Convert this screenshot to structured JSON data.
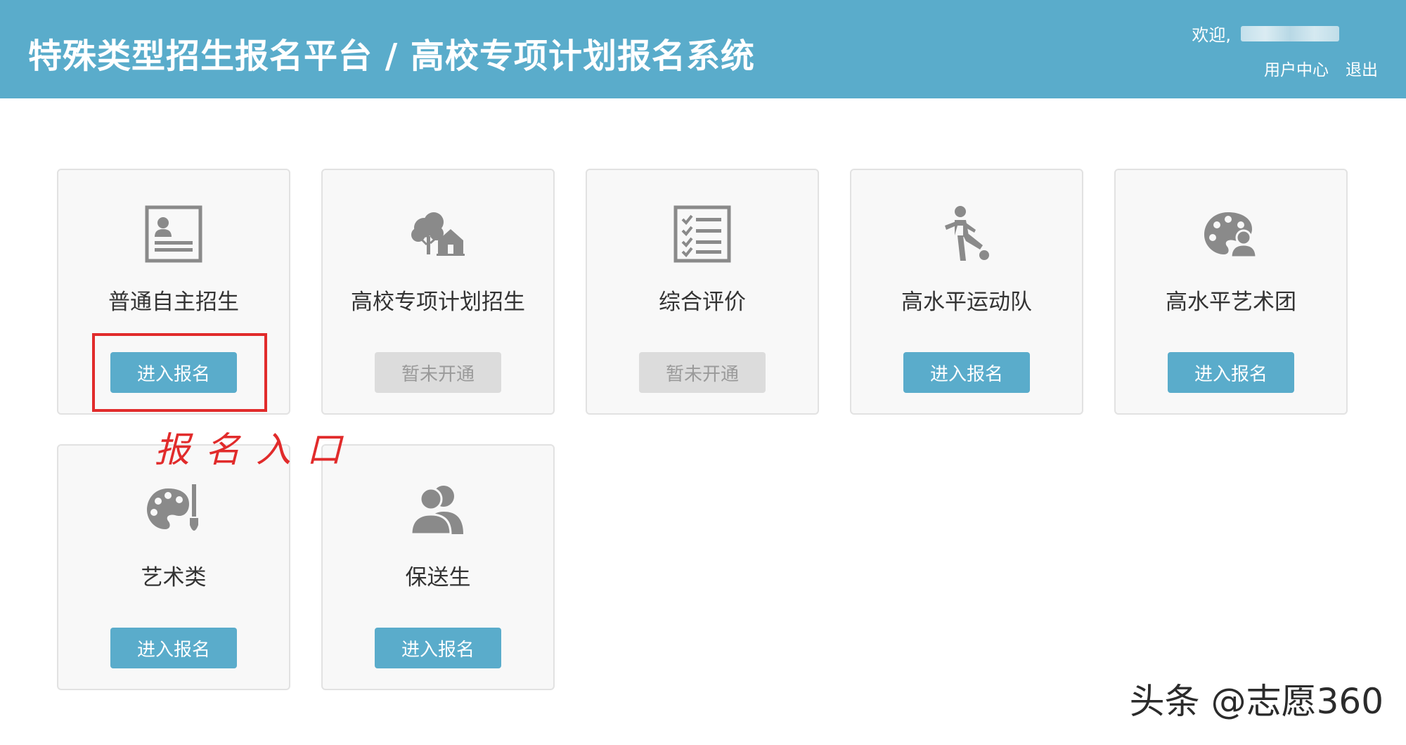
{
  "header": {
    "title": "特殊类型招生报名平台 / 高校专项计划报名系统",
    "welcome_text": "欢迎,",
    "user_center_link": "用户中心",
    "logout_link": "退出",
    "background_color": "#5aaccb"
  },
  "cards": [
    {
      "title": "普通自主招生",
      "icon": "id-card-icon",
      "button_label": "进入报名",
      "button_enabled": true
    },
    {
      "title": "高校专项计划招生",
      "icon": "tree-house-icon",
      "button_label": "暂未开通",
      "button_enabled": false
    },
    {
      "title": "综合评价",
      "icon": "checklist-icon",
      "button_label": "暂未开通",
      "button_enabled": false
    },
    {
      "title": "高水平运动队",
      "icon": "soccer-player-icon",
      "button_label": "进入报名",
      "button_enabled": true
    },
    {
      "title": "高水平艺术团",
      "icon": "palette-person-icon",
      "button_label": "进入报名",
      "button_enabled": true
    },
    {
      "title": "艺术类",
      "icon": "palette-brush-icon",
      "button_label": "进入报名",
      "button_enabled": true
    },
    {
      "title": "保送生",
      "icon": "users-icon",
      "button_label": "进入报名",
      "button_enabled": true
    }
  ],
  "annotation": {
    "text": "报名入口",
    "color": "#e12b2b"
  },
  "watermark": {
    "text": "头条 @志愿360"
  },
  "colors": {
    "button_active": "#5aaccb",
    "button_disabled": "#dcdcdc",
    "icon_gray": "#8a8a8a"
  }
}
